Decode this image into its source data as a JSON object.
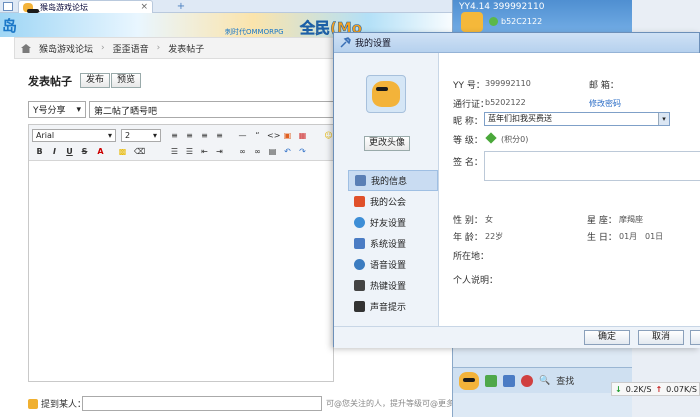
{
  "browser": {
    "tab_title": "_猴岛游戏论坛",
    "close_glyph": "×",
    "new_tab_glyph": "+"
  },
  "banner": {
    "left_text": "岛",
    "main_text": "全民(Mo",
    "sub_text": "刺时代OMMORPG"
  },
  "breadcrumb": {
    "items": [
      "猴岛游戏论坛",
      "歪歪语音",
      "发表帖子"
    ],
    "separator": "›"
  },
  "post": {
    "heading": "发表帖子",
    "publish_label": "发布",
    "preview_label": "预览",
    "type_select": "Y号分享",
    "subject": "第二帖了晒号吧"
  },
  "editor": {
    "font_family": "Arial",
    "font_size": "2"
  },
  "mention": {
    "label": "提到某人：",
    "tip": "可@您关注的人，提升等级可@更多人"
  },
  "yy_panel": {
    "header": "YY4.14 399992110",
    "id_display": "b52C2122",
    "search_label": "查找",
    "speed_down": "0.2K/S",
    "speed_up": "0.07K/S"
  },
  "dialog": {
    "title": "我的设置",
    "change_avatar": "更改头像",
    "menu": [
      {
        "label": "我的信息",
        "icon": "user-card-icon",
        "color": "#5a7fb5"
      },
      {
        "label": "我的公会",
        "icon": "flag-icon",
        "color": "#e0502a"
      },
      {
        "label": "好友设置",
        "icon": "friend-icon",
        "color": "#3e8ed6"
      },
      {
        "label": "系统设置",
        "icon": "tools-icon",
        "color": "#4b7cc4"
      },
      {
        "label": "语音设置",
        "icon": "voice-icon",
        "color": "#3c7cc0"
      },
      {
        "label": "热键设置",
        "icon": "keyboard-icon",
        "color": "#444"
      },
      {
        "label": "声音提示",
        "icon": "sound-icon",
        "color": "#333"
      }
    ],
    "info": {
      "yy_label": "YY 号：",
      "yy_value": "399992110",
      "mail_label": "邮 箱：",
      "pass_label": "通行证：",
      "pass_value": "b5202122",
      "change_pwd": "修改密码",
      "nick_label": "昵 称：",
      "nick_value": "蓝年们扣我买费送",
      "level_label": "等 级：",
      "level_value": "(积分0)",
      "sign_label": "签 名：",
      "gender_label": "性 别：",
      "gender_value": "女",
      "zodiac_label": "星 座：",
      "zodiac_value": "摩羯座",
      "age_label": "年 龄：",
      "age_value": "22岁",
      "birthday_label": "生 日：",
      "birthday_month": "01月",
      "birthday_day": "01日",
      "location_label": "所在地：",
      "profile_label": "个人说明："
    },
    "ok_label": "确定",
    "cancel_label": "取消"
  }
}
